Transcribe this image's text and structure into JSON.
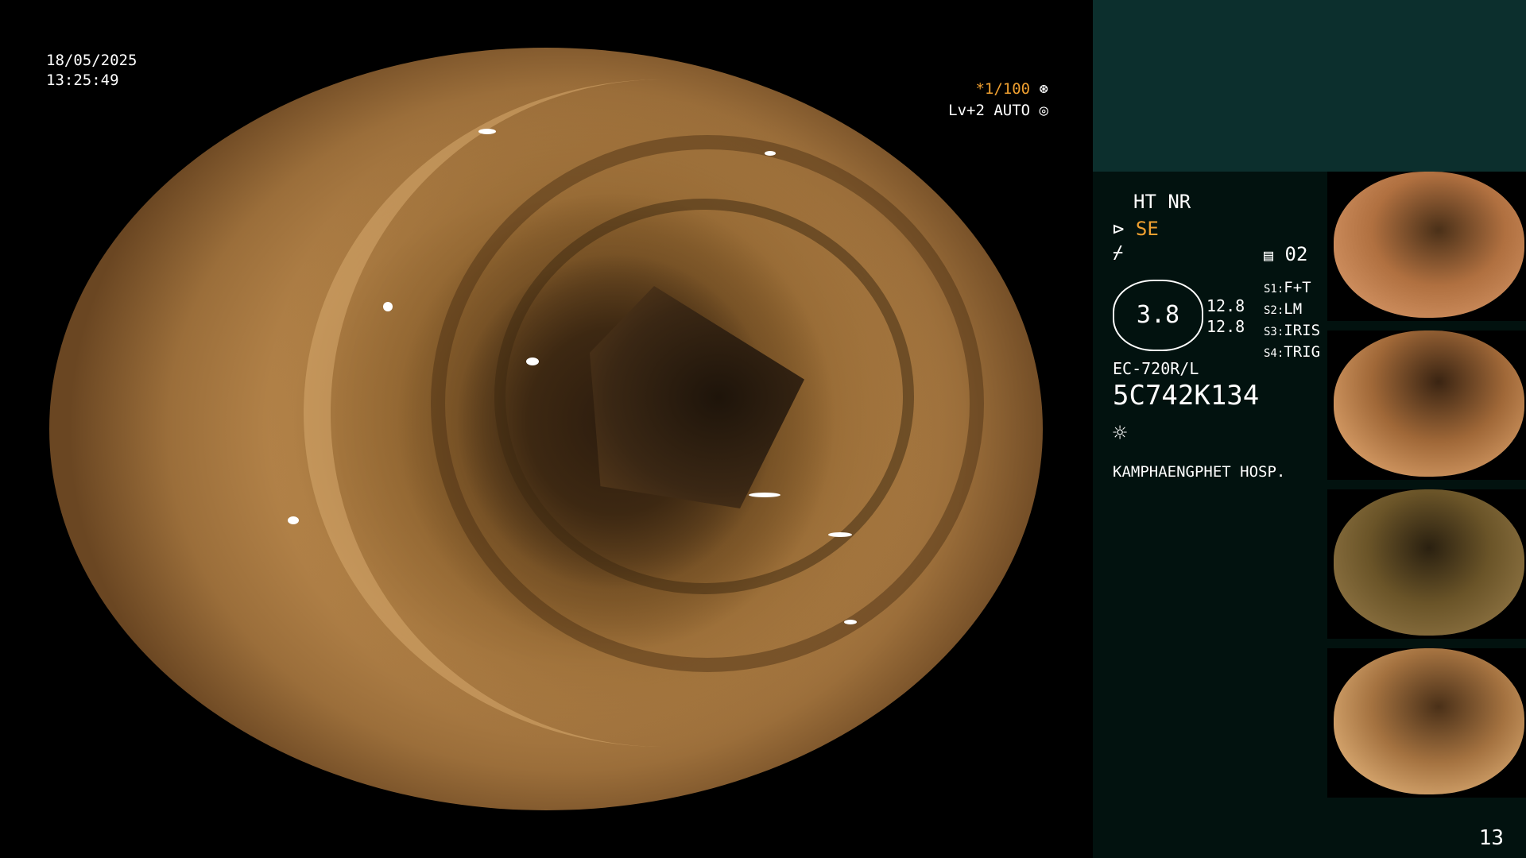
{
  "overlay": {
    "date": "18/05/2025",
    "time": "13:25:49",
    "shutter": "*1/100",
    "level": "Lv+2 AUTO"
  },
  "info": {
    "ht_nr": "HT NR",
    "se": "SE",
    "memory_label": "02",
    "scope_value": "3.8",
    "param1": "12.8",
    "param2": "12.8",
    "switches": [
      {
        "key": "S1:",
        "value": "F+T"
      },
      {
        "key": "S2:",
        "value": "LM"
      },
      {
        "key": "S3:",
        "value": "IRIS"
      },
      {
        "key": "S4:",
        "value": "TRIG"
      }
    ],
    "model": "EC-720R/L",
    "serial": "5C742K134",
    "hospital": "KAMPHAENGPHET HOSP."
  },
  "page_number": "13",
  "colors": {
    "accent_orange": "#f0a030",
    "sidebar_bg": "#02120f",
    "sidebar_top": "#0c2f2d"
  },
  "icons": [
    "aperture-icon",
    "auto-icon",
    "scope-tip-icon",
    "memory-icon",
    "light-icon"
  ]
}
